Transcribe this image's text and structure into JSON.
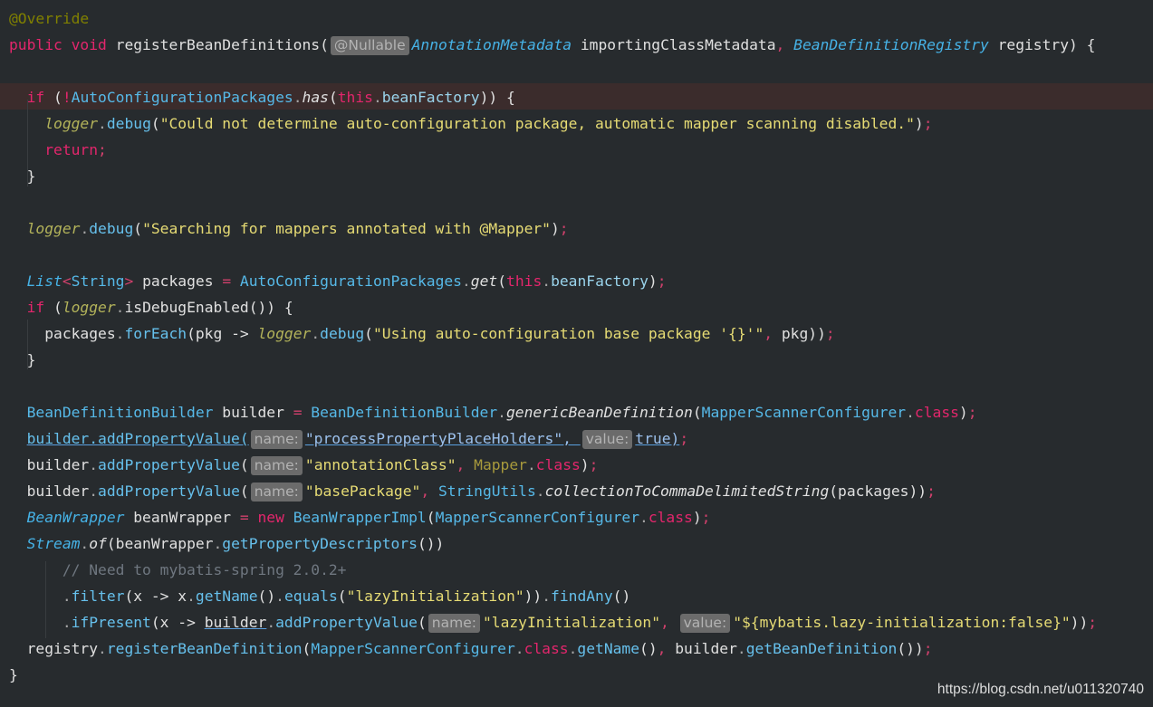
{
  "editor": {
    "lines": [
      [
        {
          "t": "@Override",
          "c": "t-ann"
        }
      ],
      [
        {
          "t": "public ",
          "c": "t-kw"
        },
        {
          "t": "void ",
          "c": "t-kw"
        },
        {
          "t": "registerBeanDefinitions",
          "c": "t-ident"
        },
        {
          "t": "(",
          "c": "t-punct"
        },
        {
          "hint": "@Nullable"
        },
        {
          "t": "AnnotationMetadata ",
          "c": "t-type"
        },
        {
          "t": "importingClassMetadata",
          "c": "t-ident"
        },
        {
          "t": ", ",
          "c": "t-semi"
        },
        {
          "t": "BeanDefinitionRegistry ",
          "c": "t-type"
        },
        {
          "t": "registry) {",
          "c": "t-ident"
        }
      ],
      [],
      [
        {
          "t": "  if ",
          "c": "t-kw"
        },
        {
          "t": "(",
          "c": "t-punct"
        },
        {
          "t": "!",
          "c": "t-kw"
        },
        {
          "t": "AutoConfigurationPackages",
          "c": "t-cls"
        },
        {
          "t": ".",
          "c": "t-dot"
        },
        {
          "t": "has",
          "c": "t-meth"
        },
        {
          "t": "(",
          "c": "t-punct"
        },
        {
          "t": "this",
          "c": "t-kw"
        },
        {
          "t": ".",
          "c": "t-dot"
        },
        {
          "t": "beanFactory",
          "c": "t-field"
        },
        {
          "t": ")) {",
          "c": "t-punct"
        }
      ],
      [
        {
          "t": "    ",
          "c": "t-plain"
        },
        {
          "t": "logger",
          "c": "t-logger"
        },
        {
          "t": ".",
          "c": "t-dot"
        },
        {
          "t": "debug",
          "c": "t-call"
        },
        {
          "t": "(",
          "c": "t-punct"
        },
        {
          "t": "\"Could not determine auto-configuration package, automatic mapper scanning disabled.\"",
          "c": "t-str"
        },
        {
          "t": ")",
          "c": "t-punct"
        },
        {
          "t": ";",
          "c": "t-semi"
        }
      ],
      [
        {
          "t": "    return",
          "c": "t-kw"
        },
        {
          "t": ";",
          "c": "t-semi"
        }
      ],
      [
        {
          "t": "  }",
          "c": "t-punct"
        }
      ],
      [],
      [
        {
          "t": "  ",
          "c": "t-plain"
        },
        {
          "t": "logger",
          "c": "t-logger"
        },
        {
          "t": ".",
          "c": "t-dot"
        },
        {
          "t": "debug",
          "c": "t-call"
        },
        {
          "t": "(",
          "c": "t-punct"
        },
        {
          "t": "\"Searching for mappers annotated with @Mapper\"",
          "c": "t-str"
        },
        {
          "t": ")",
          "c": "t-punct"
        },
        {
          "t": ";",
          "c": "t-semi"
        }
      ],
      [],
      [
        {
          "t": "  List",
          "c": "t-type"
        },
        {
          "t": "<",
          "c": "t-semi"
        },
        {
          "t": "String",
          "c": "t-cls"
        },
        {
          "t": "> ",
          "c": "t-semi"
        },
        {
          "t": "packages ",
          "c": "t-ident"
        },
        {
          "t": "= ",
          "c": "t-semi"
        },
        {
          "t": "AutoConfigurationPackages",
          "c": "t-cls"
        },
        {
          "t": ".",
          "c": "t-dot"
        },
        {
          "t": "get",
          "c": "t-meth"
        },
        {
          "t": "(",
          "c": "t-punct"
        },
        {
          "t": "this",
          "c": "t-kw"
        },
        {
          "t": ".",
          "c": "t-dot"
        },
        {
          "t": "beanFactory",
          "c": "t-field"
        },
        {
          "t": ")",
          "c": "t-punct"
        },
        {
          "t": ";",
          "c": "t-semi"
        }
      ],
      [
        {
          "t": "  if ",
          "c": "t-kw"
        },
        {
          "t": "(",
          "c": "t-punct"
        },
        {
          "t": "logger",
          "c": "t-logger"
        },
        {
          "t": ".",
          "c": "t-dot"
        },
        {
          "t": "isDebugEnabled",
          "c": "t-ident"
        },
        {
          "t": "()) {",
          "c": "t-punct"
        }
      ],
      [
        {
          "t": "    packages",
          "c": "t-ident"
        },
        {
          "t": ".",
          "c": "t-dot"
        },
        {
          "t": "forEach",
          "c": "t-call"
        },
        {
          "t": "(pkg -> ",
          "c": "t-ident"
        },
        {
          "t": "logger",
          "c": "t-logger"
        },
        {
          "t": ".",
          "c": "t-dot"
        },
        {
          "t": "debug",
          "c": "t-call"
        },
        {
          "t": "(",
          "c": "t-punct"
        },
        {
          "t": "\"Using auto-configuration base package '{}'\"",
          "c": "t-str"
        },
        {
          "t": ", ",
          "c": "t-semi"
        },
        {
          "t": "pkg))",
          "c": "t-ident"
        },
        {
          "t": ";",
          "c": "t-semi"
        }
      ],
      [
        {
          "t": "  }",
          "c": "t-punct"
        }
      ],
      [],
      [
        {
          "t": "  BeanDefinitionBuilder ",
          "c": "t-cls"
        },
        {
          "t": "builder ",
          "c": "t-ident"
        },
        {
          "t": "= ",
          "c": "t-semi"
        },
        {
          "t": "BeanDefinitionBuilder",
          "c": "t-cls"
        },
        {
          "t": ".",
          "c": "t-dot"
        },
        {
          "t": "genericBeanDefinition",
          "c": "t-meth"
        },
        {
          "t": "(",
          "c": "t-punct"
        },
        {
          "t": "MapperScannerConfigurer",
          "c": "t-cls"
        },
        {
          "t": ".",
          "c": "t-dot"
        },
        {
          "t": "class",
          "c": "t-kw"
        },
        {
          "t": ")",
          "c": "t-punct"
        },
        {
          "t": ";",
          "c": "t-semi"
        }
      ],
      [
        {
          "t": "  ",
          "c": "t-plain"
        },
        {
          "t": "builder.addPropertyValue(",
          "c": "t-call u"
        },
        {
          "hint": "name:",
          "u": true
        },
        {
          "t": "\"processPropertyPlaceHolders\", ",
          "c": "t-str2 u"
        },
        {
          "hint": "value:",
          "u": true
        },
        {
          "t": "true)",
          "c": "t-str2 u"
        },
        {
          "t": ";",
          "c": "t-semi"
        }
      ],
      [
        {
          "t": "  builder",
          "c": "t-ident"
        },
        {
          "t": ".",
          "c": "t-dot"
        },
        {
          "t": "addPropertyValue",
          "c": "t-call"
        },
        {
          "t": "(",
          "c": "t-punct"
        },
        {
          "hint": "name:"
        },
        {
          "t": "\"annotationClass\"",
          "c": "t-str"
        },
        {
          "t": ", ",
          "c": "t-semi"
        },
        {
          "t": "Mapper",
          "c": "t-gold"
        },
        {
          "t": ".",
          "c": "t-dot"
        },
        {
          "t": "class",
          "c": "t-kw"
        },
        {
          "t": ")",
          "c": "t-punct"
        },
        {
          "t": ";",
          "c": "t-semi"
        }
      ],
      [
        {
          "t": "  builder",
          "c": "t-ident"
        },
        {
          "t": ".",
          "c": "t-dot"
        },
        {
          "t": "addPropertyValue",
          "c": "t-call"
        },
        {
          "t": "(",
          "c": "t-punct"
        },
        {
          "hint": "name:"
        },
        {
          "t": "\"basePackage\"",
          "c": "t-str"
        },
        {
          "t": ", ",
          "c": "t-semi"
        },
        {
          "t": "StringUtils",
          "c": "t-cls"
        },
        {
          "t": ".",
          "c": "t-dot"
        },
        {
          "t": "collectionToCommaDelimitedString",
          "c": "t-meth"
        },
        {
          "t": "(packages))",
          "c": "t-ident"
        },
        {
          "t": ";",
          "c": "t-semi"
        }
      ],
      [
        {
          "t": "  BeanWrapper ",
          "c": "t-type"
        },
        {
          "t": "beanWrapper ",
          "c": "t-ident"
        },
        {
          "t": "= ",
          "c": "t-semi"
        },
        {
          "t": "new ",
          "c": "t-kw"
        },
        {
          "t": "BeanWrapperImpl",
          "c": "t-cls"
        },
        {
          "t": "(",
          "c": "t-punct"
        },
        {
          "t": "MapperScannerConfigurer",
          "c": "t-cls"
        },
        {
          "t": ".",
          "c": "t-dot"
        },
        {
          "t": "class",
          "c": "t-kw"
        },
        {
          "t": ")",
          "c": "t-punct"
        },
        {
          "t": ";",
          "c": "t-semi"
        }
      ],
      [
        {
          "t": "  Stream",
          "c": "t-type"
        },
        {
          "t": ".",
          "c": "t-dot"
        },
        {
          "t": "of",
          "c": "t-meth"
        },
        {
          "t": "(beanWrapper",
          "c": "t-ident"
        },
        {
          "t": ".",
          "c": "t-dot"
        },
        {
          "t": "getPropertyDescriptors",
          "c": "t-call"
        },
        {
          "t": "())",
          "c": "t-punct"
        }
      ],
      [
        {
          "t": "      // Need to mybatis-spring 2.0.2+",
          "c": "t-comment"
        }
      ],
      [
        {
          "t": "      .",
          "c": "t-dot"
        },
        {
          "t": "filter",
          "c": "t-call"
        },
        {
          "t": "(x -> x",
          "c": "t-ident"
        },
        {
          "t": ".",
          "c": "t-dot"
        },
        {
          "t": "getName",
          "c": "t-call"
        },
        {
          "t": "()",
          "c": "t-punct"
        },
        {
          "t": ".",
          "c": "t-dot"
        },
        {
          "t": "equals",
          "c": "t-call"
        },
        {
          "t": "(",
          "c": "t-punct"
        },
        {
          "t": "\"lazyInitialization\"",
          "c": "t-str"
        },
        {
          "t": "))",
          "c": "t-punct"
        },
        {
          "t": ".",
          "c": "t-dot"
        },
        {
          "t": "findAny",
          "c": "t-call"
        },
        {
          "t": "()",
          "c": "t-punct"
        }
      ],
      [
        {
          "t": "      .",
          "c": "t-dot"
        },
        {
          "t": "ifPresent",
          "c": "t-call"
        },
        {
          "t": "(x -> ",
          "c": "t-ident"
        },
        {
          "t": "builder",
          "c": "t-ident u"
        },
        {
          "t": ".",
          "c": "t-dot"
        },
        {
          "t": "addPropertyValue",
          "c": "t-call"
        },
        {
          "t": "(",
          "c": "t-punct"
        },
        {
          "hint": "name:"
        },
        {
          "t": "\"lazyInitialization\"",
          "c": "t-str"
        },
        {
          "t": ", ",
          "c": "t-semi"
        },
        {
          "hint": "value:"
        },
        {
          "t": "\"${mybatis.lazy-initialization:false}\"",
          "c": "t-str"
        },
        {
          "t": "))",
          "c": "t-punct"
        },
        {
          "t": ";",
          "c": "t-semi"
        }
      ],
      [
        {
          "t": "  registry",
          "c": "t-ident"
        },
        {
          "t": ".",
          "c": "t-dot"
        },
        {
          "t": "registerBeanDefinition",
          "c": "t-call"
        },
        {
          "t": "(",
          "c": "t-punct"
        },
        {
          "t": "MapperScannerConfigurer",
          "c": "t-cls"
        },
        {
          "t": ".",
          "c": "t-dot"
        },
        {
          "t": "class",
          "c": "t-kw"
        },
        {
          "t": ".",
          "c": "t-dot"
        },
        {
          "t": "getName",
          "c": "t-call"
        },
        {
          "t": "()",
          "c": "t-punct"
        },
        {
          "t": ", ",
          "c": "t-semi"
        },
        {
          "t": "builder",
          "c": "t-ident"
        },
        {
          "t": ".",
          "c": "t-dot"
        },
        {
          "t": "getBeanDefinition",
          "c": "t-call"
        },
        {
          "t": "())",
          "c": "t-punct"
        },
        {
          "t": ";",
          "c": "t-semi"
        }
      ],
      [
        {
          "t": "}",
          "c": "t-punct"
        }
      ]
    ]
  },
  "watermark": "https://blog.csdn.net/u011320740"
}
